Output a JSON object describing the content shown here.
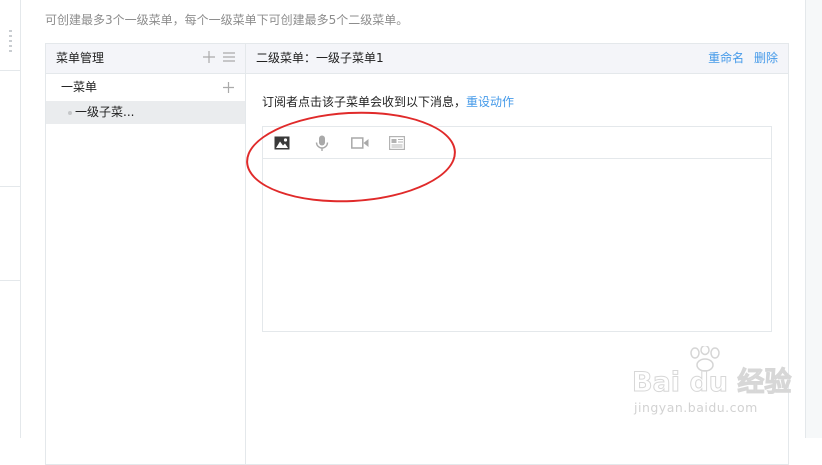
{
  "hint": "可创建最多3个一级菜单，每个一级菜单下可创建最多5个二级菜单。",
  "menu_panel": {
    "title": "菜单管理",
    "add_icon": "plus-icon",
    "sort_icon": "list-icon",
    "items": [
      {
        "label": "一菜单",
        "add_icon": "plus-icon",
        "children": [
          {
            "label": "一级子菜..."
          }
        ]
      }
    ]
  },
  "detail_panel": {
    "title": "二级菜单：一级子菜单1",
    "rename_label": "重命名",
    "delete_label": "删除",
    "message_prompt": "订阅者点击该子菜单会收到以下消息，",
    "reset_action_label": "重设动作",
    "toolbar": [
      {
        "name": "image-icon"
      },
      {
        "name": "microphone-icon"
      },
      {
        "name": "video-icon"
      },
      {
        "name": "news-icon"
      }
    ]
  },
  "annotation": {
    "shape": "ellipse",
    "color": "#e02a2a"
  },
  "watermark": {
    "brand": "Bai du 经验",
    "url": "jingyan.baidu.com"
  },
  "colors": {
    "link": "#459ae9",
    "header_bg": "#f4f5f9",
    "border": "#e4e8eb",
    "selected_bg": "#eaecee",
    "hint_text": "#8d8d8d"
  }
}
